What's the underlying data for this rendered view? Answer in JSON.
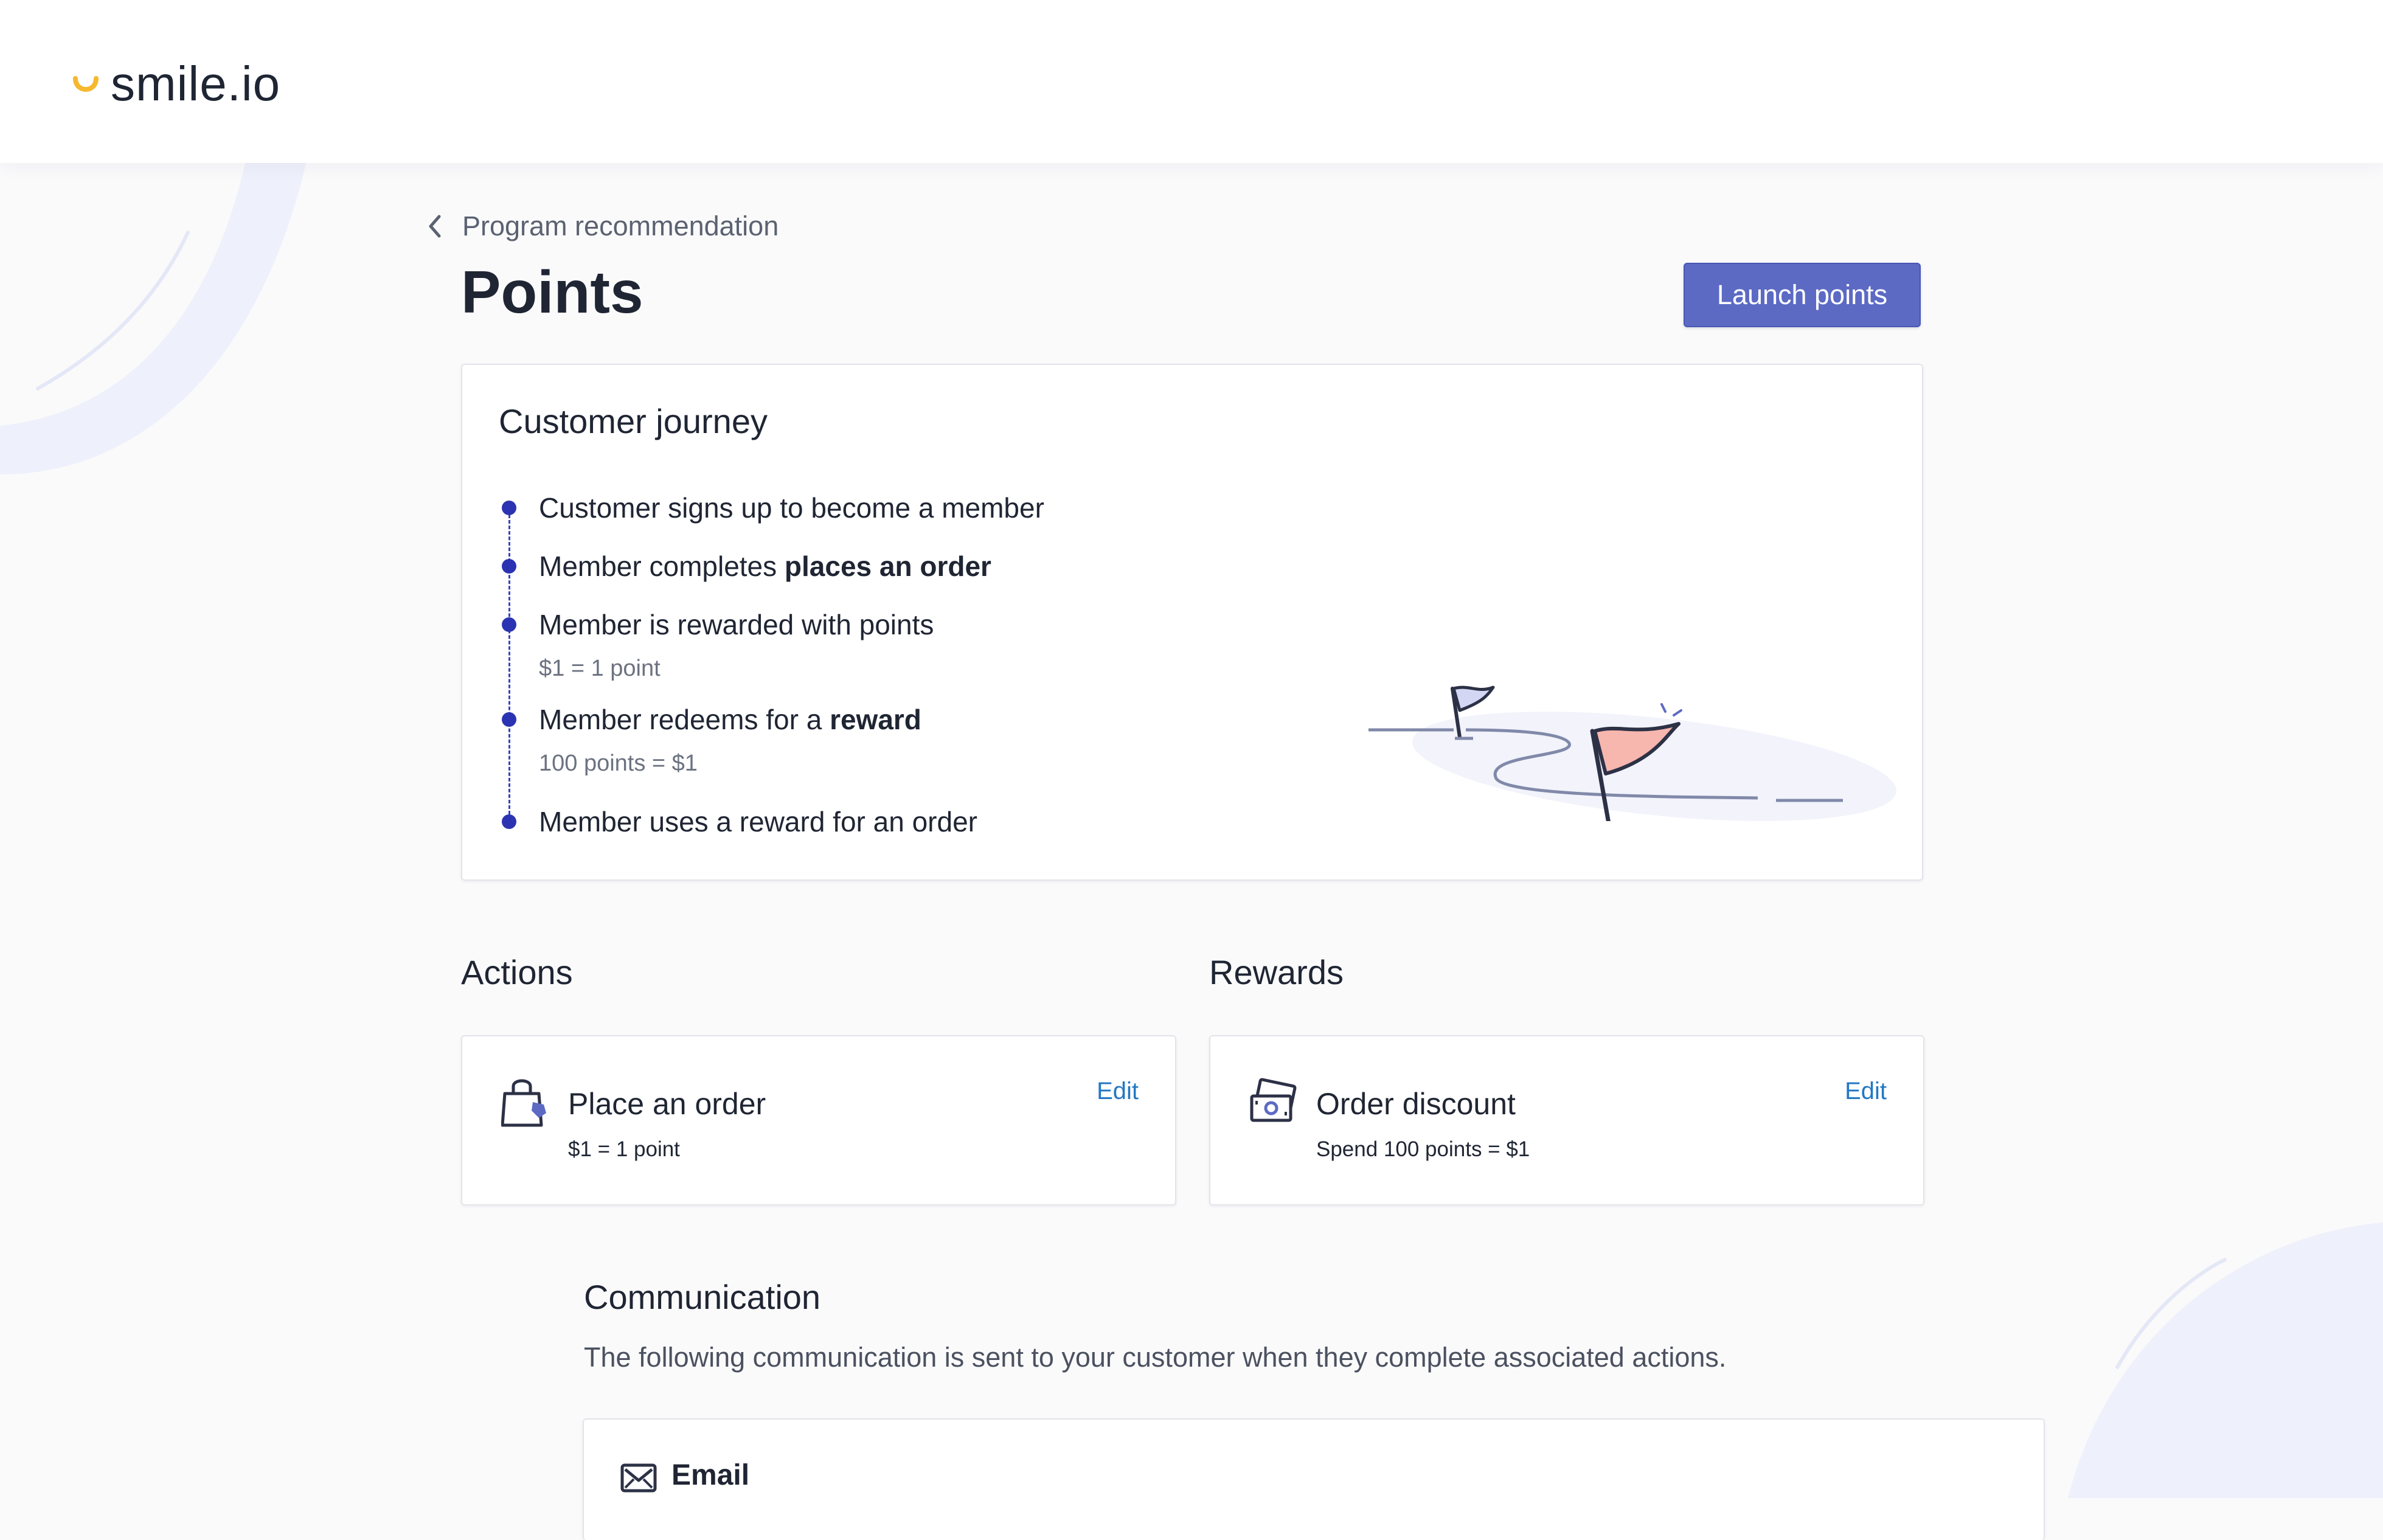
{
  "header": {
    "logo_text": "smile.io",
    "logo_color": "#f5b82e"
  },
  "breadcrumb": {
    "back_label": "Program recommendation"
  },
  "page": {
    "title": "Points",
    "primary_action": "Launch points",
    "primary_color": "#5c6ac4"
  },
  "journey": {
    "title": "Customer journey",
    "steps": [
      {
        "text": "Customer signs up to become a member",
        "bold": "",
        "sub": ""
      },
      {
        "text": "Member completes ",
        "bold": "places an order",
        "sub": ""
      },
      {
        "text": "Member is rewarded with points",
        "bold": "",
        "sub": "$1 = 1 point"
      },
      {
        "text": "Member redeems for a ",
        "bold": "reward",
        "sub": "100 points = $1"
      },
      {
        "text": "Member uses a reward for an order",
        "bold": "",
        "sub": ""
      }
    ],
    "dot_color": "#2c33b2"
  },
  "actions": {
    "title": "Actions",
    "items": [
      {
        "title": "Place an order",
        "sub": "$1 = 1 point",
        "edit": "Edit",
        "icon": "shopping-bag-icon"
      }
    ]
  },
  "rewards": {
    "title": "Rewards",
    "items": [
      {
        "title": "Order discount",
        "sub": "Spend 100 points = $1",
        "edit": "Edit",
        "icon": "cash-discount-icon"
      }
    ]
  },
  "communication": {
    "title": "Communication",
    "description": "The following communication is sent to your customer when they complete associated actions.",
    "channels": [
      {
        "title": "Email",
        "icon": "envelope-icon"
      }
    ]
  },
  "link_color": "#2378c4"
}
